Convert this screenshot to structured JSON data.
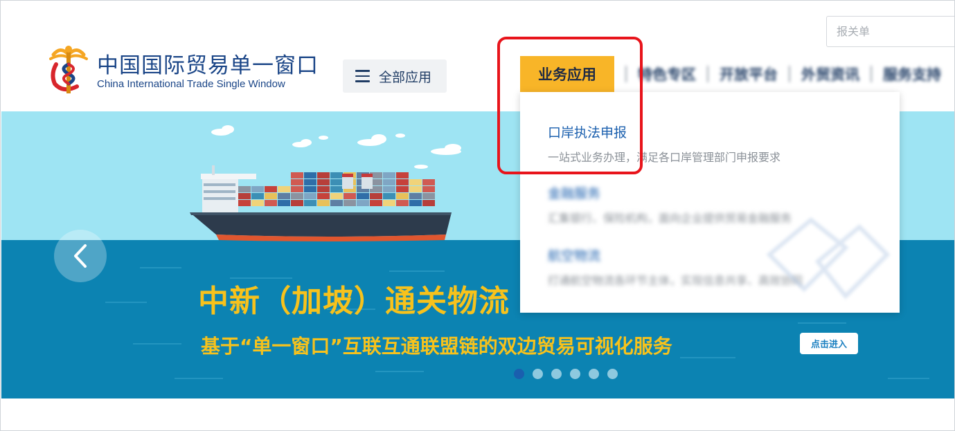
{
  "header": {
    "search_placeholder": "报关单",
    "logo_cn": "中国国际贸易单一窗口",
    "logo_en": "China International Trade Single Window",
    "all_apps_label": "全部应用"
  },
  "nav": {
    "active_label": "业务应用",
    "items": [
      "特色专区",
      "开放平台",
      "外贸资讯",
      "服务支持"
    ]
  },
  "dropdown": {
    "items": [
      {
        "title": "口岸执法申报",
        "desc": "一站式业务办理，满足各口岸管理部门申报要求"
      },
      {
        "title": "金融服务",
        "desc": "汇集银行、保险机构，面向企业提供贸易金融服务"
      },
      {
        "title": "航空物流",
        "desc": "打通航空物流各环节主体，实现信息共享、高效协同"
      }
    ]
  },
  "banner": {
    "headline": "中新（加坡）通关物流",
    "subline": "基于“单一窗口”互联互通联盟链的双边贸易可视化服务",
    "enter_label": "点击进入",
    "slide_count": 6,
    "active_slide": 1
  },
  "colors": {
    "brand_blue": "#1a4587",
    "nav_active_bg": "#f8b528",
    "sky": "#9ee4f3",
    "sea": "#0c83b2",
    "headline": "#f7c21c",
    "highlight": "#e8141b"
  }
}
